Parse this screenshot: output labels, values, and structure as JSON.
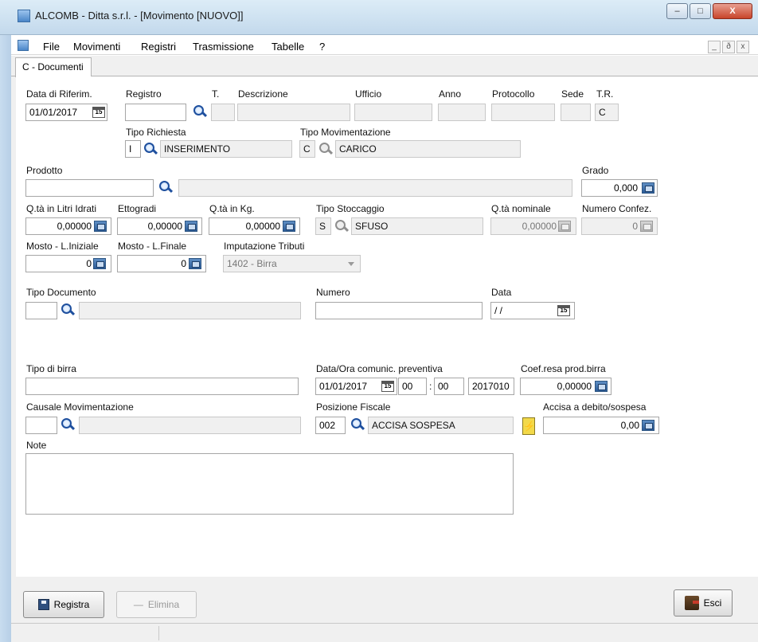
{
  "window": {
    "title": "ALCOMB - Ditta s.r.l. - [Movimento  [NUOVO]]"
  },
  "menu": {
    "items": [
      "File",
      "Movimenti",
      "Registri",
      "Trasmissione",
      "Tabelle",
      "?"
    ]
  },
  "tab": {
    "label": "C - Documenti"
  },
  "labels": {
    "data_riferim": "Data di Riferim.",
    "registro": "Registro",
    "t": "T.",
    "descrizione": "Descrizione",
    "ufficio": "Ufficio",
    "anno": "Anno",
    "protocollo": "Protocollo",
    "sede": "Sede",
    "tr": "T.R.",
    "tipo_richiesta": "Tipo Richiesta",
    "tipo_movimentazione": "Tipo Movimentazione",
    "prodotto": "Prodotto",
    "grado": "Grado",
    "qta_litri": "Q.tà in Litri Idrati",
    "ettogradi": "Ettogradi",
    "qta_kg": "Q.tà in Kg.",
    "tipo_stoccaggio": "Tipo Stoccaggio",
    "qta_nominale": "Q.tà nominale",
    "numero_confez": "Numero Confez.",
    "mosto_iniziale": "Mosto - L.Iniziale",
    "mosto_finale": "Mosto - L.Finale",
    "imputazione_tributi": "Imputazione Tributi",
    "tipo_documento": "Tipo Documento",
    "numero": "Numero",
    "data": "Data",
    "tipo_birra": "Tipo di birra",
    "data_ora_comunic": "Data/Ora comunic. preventiva",
    "coef_resa": "Coef.resa prod.birra",
    "causale": "Causale Movimentazione",
    "posizione_fiscale": "Posizione Fiscale",
    "accisa": "Accisa a debito/sospesa",
    "note": "Note"
  },
  "values": {
    "data_riferim": "01/01/2017",
    "tr": "C",
    "tipo_richiesta_code": "I",
    "tipo_richiesta_desc": "INSERIMENTO",
    "tipo_mov_code": "C",
    "tipo_mov_desc": "CARICO",
    "grado": "0,000",
    "qta_litri": "0,00000",
    "ettogradi": "0,00000",
    "qta_kg": "0,00000",
    "stoccaggio_code": "S",
    "stoccaggio_desc": "SFUSO",
    "qta_nominale": "0,00000",
    "numero_confez": "0",
    "mosto_iniziale": "0",
    "mosto_finale": "0",
    "imputazione_tributi": "1402 - Birra",
    "data_doc": "/ /",
    "data_comunic": "01/01/2017",
    "ora": "00",
    "minuti": "00",
    "anno_comunic": "2017010",
    "time_sep": ":",
    "coef_resa": "0,00000",
    "pos_fiscale_code": "002",
    "pos_fiscale_desc": "ACCISA SOSPESA",
    "accisa": "0,00"
  },
  "buttons": {
    "registra": "Registra",
    "elimina": "Elimina",
    "esci": "Esci"
  },
  "window_buttons": {
    "minimize": "–",
    "maximize": "□",
    "close": "X"
  },
  "mdi_buttons": {
    "minimize": "_",
    "restore": "ð",
    "close": "x"
  },
  "calendar_day": "15",
  "elimina_symbol": "—"
}
